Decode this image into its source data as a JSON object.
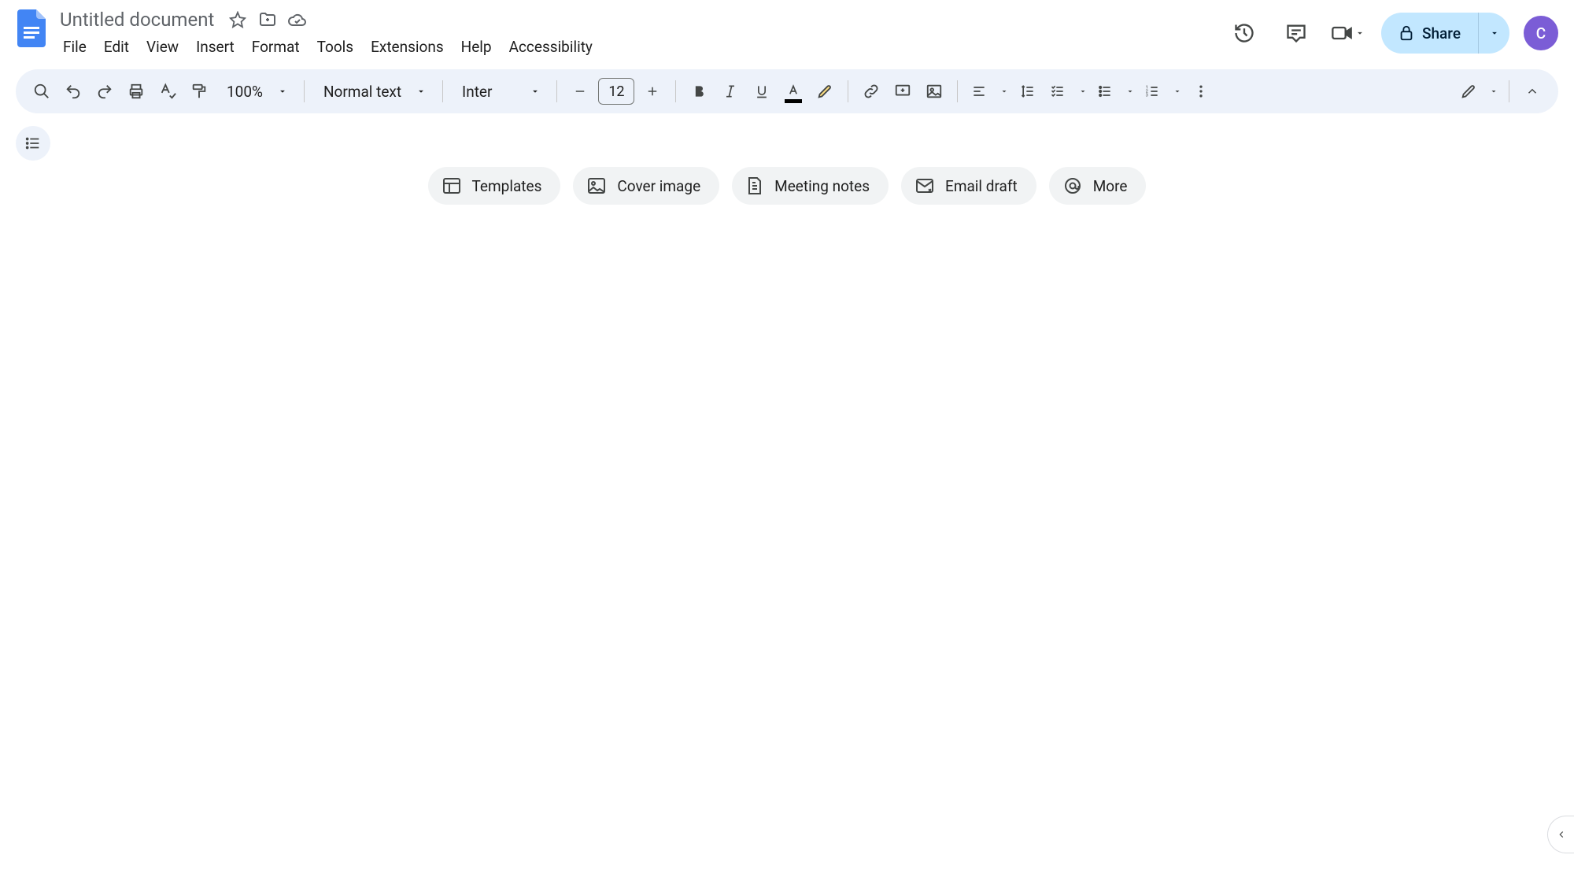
{
  "header": {
    "title": "Untitled document",
    "menu": [
      "File",
      "Edit",
      "View",
      "Insert",
      "Format",
      "Tools",
      "Extensions",
      "Help",
      "Accessibility"
    ],
    "share_label": "Share",
    "avatar_letter": "C"
  },
  "toolbar": {
    "zoom": "100%",
    "style": "Normal text",
    "font": "Inter",
    "font_size": "12"
  },
  "suggestions": {
    "templates": "Templates",
    "cover": "Cover image",
    "meeting": "Meeting notes",
    "email": "Email draft",
    "more": "More"
  }
}
